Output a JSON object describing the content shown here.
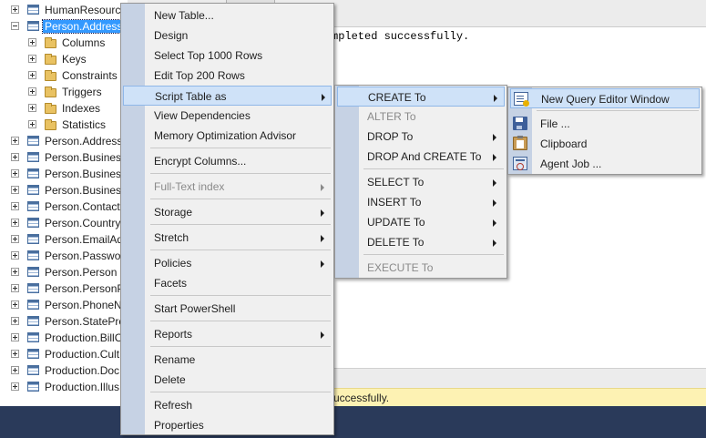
{
  "tree": {
    "items": [
      {
        "label": "HumanResourc",
        "expander": "plus",
        "icon": "table-icon"
      },
      {
        "label": "Person.Address",
        "expander": "minus",
        "icon": "table-icon",
        "selected": true
      },
      {
        "label": "Columns",
        "expander": "plus",
        "icon": "folder-icon"
      },
      {
        "label": "Keys",
        "expander": "plus",
        "icon": "folder-icon"
      },
      {
        "label": "Constraints",
        "expander": "plus",
        "icon": "folder-icon"
      },
      {
        "label": "Triggers",
        "expander": "plus",
        "icon": "folder-icon"
      },
      {
        "label": "Indexes",
        "expander": "plus",
        "icon": "folder-icon"
      },
      {
        "label": "Statistics",
        "expander": "plus",
        "icon": "folder-icon"
      },
      {
        "label": "Person.AddressT",
        "expander": "plus",
        "icon": "table-icon"
      },
      {
        "label": "Person.Business",
        "expander": "plus",
        "icon": "table-icon"
      },
      {
        "label": "Person.Business",
        "expander": "plus",
        "icon": "table-icon"
      },
      {
        "label": "Person.Business",
        "expander": "plus",
        "icon": "table-icon"
      },
      {
        "label": "Person.ContactT",
        "expander": "plus",
        "icon": "table-icon"
      },
      {
        "label": "Person.Country",
        "expander": "plus",
        "icon": "table-icon"
      },
      {
        "label": "Person.EmailAd",
        "expander": "plus",
        "icon": "table-icon"
      },
      {
        "label": "Person.Passwor",
        "expander": "plus",
        "icon": "table-icon"
      },
      {
        "label": "Person.Person",
        "expander": "plus",
        "icon": "table-icon"
      },
      {
        "label": "Person.PersonP",
        "expander": "plus",
        "icon": "table-icon"
      },
      {
        "label": "Person.PhoneN",
        "expander": "plus",
        "icon": "table-icon"
      },
      {
        "label": "Person.StatePro",
        "expander": "plus",
        "icon": "table-icon"
      },
      {
        "label": "Production.BillC",
        "expander": "plus",
        "icon": "table-icon"
      },
      {
        "label": "Production.Cult",
        "expander": "plus",
        "icon": "table-icon"
      },
      {
        "label": "Production.Doc",
        "expander": "plus",
        "icon": "table-icon"
      },
      {
        "label": "Production.Illus",
        "expander": "plus",
        "icon": "table-icon"
      }
    ]
  },
  "query": {
    "message": "mpleted successfully.",
    "status": "uccessfully."
  },
  "context_menu": {
    "items": [
      {
        "label": "New Table..."
      },
      {
        "label": "Design"
      },
      {
        "label": "Select Top 1000 Rows"
      },
      {
        "label": "Edit Top 200 Rows"
      },
      {
        "label": "Script Table as",
        "submenu": true,
        "highlighted": true
      },
      {
        "label": "View Dependencies"
      },
      {
        "label": "Memory Optimization Advisor"
      },
      {
        "separator": true
      },
      {
        "label": "Encrypt Columns..."
      },
      {
        "separator": true
      },
      {
        "label": "Full-Text index",
        "submenu": true,
        "disabled": true
      },
      {
        "separator": true
      },
      {
        "label": "Storage",
        "submenu": true
      },
      {
        "separator": true
      },
      {
        "label": "Stretch",
        "submenu": true
      },
      {
        "separator": true
      },
      {
        "label": "Policies",
        "submenu": true
      },
      {
        "label": "Facets"
      },
      {
        "separator": true
      },
      {
        "label": "Start PowerShell"
      },
      {
        "separator": true
      },
      {
        "label": "Reports",
        "submenu": true
      },
      {
        "separator": true
      },
      {
        "label": "Rename"
      },
      {
        "label": "Delete"
      },
      {
        "separator": true
      },
      {
        "label": "Refresh"
      },
      {
        "label": "Properties"
      }
    ]
  },
  "script_submenu": {
    "items": [
      {
        "label": "CREATE To",
        "submenu": true,
        "highlighted": true
      },
      {
        "label": "ALTER To",
        "disabled": true
      },
      {
        "label": "DROP To",
        "submenu": true
      },
      {
        "label": "DROP And CREATE To",
        "submenu": true
      },
      {
        "separator": true
      },
      {
        "label": "SELECT To",
        "submenu": true
      },
      {
        "label": "INSERT To",
        "submenu": true
      },
      {
        "label": "UPDATE To",
        "submenu": true
      },
      {
        "label": "DELETE To",
        "submenu": true
      },
      {
        "separator": true
      },
      {
        "label": "EXECUTE To",
        "disabled": true
      }
    ]
  },
  "create_submenu": {
    "items": [
      {
        "label": "New Query Editor Window",
        "icon": "query-editor-icon",
        "highlighted": true
      },
      {
        "separator": true
      },
      {
        "label": "File ...",
        "icon": "save-icon"
      },
      {
        "label": "Clipboard",
        "icon": "clipboard-icon"
      },
      {
        "label": "Agent Job ...",
        "icon": "agent-job-icon"
      }
    ]
  }
}
